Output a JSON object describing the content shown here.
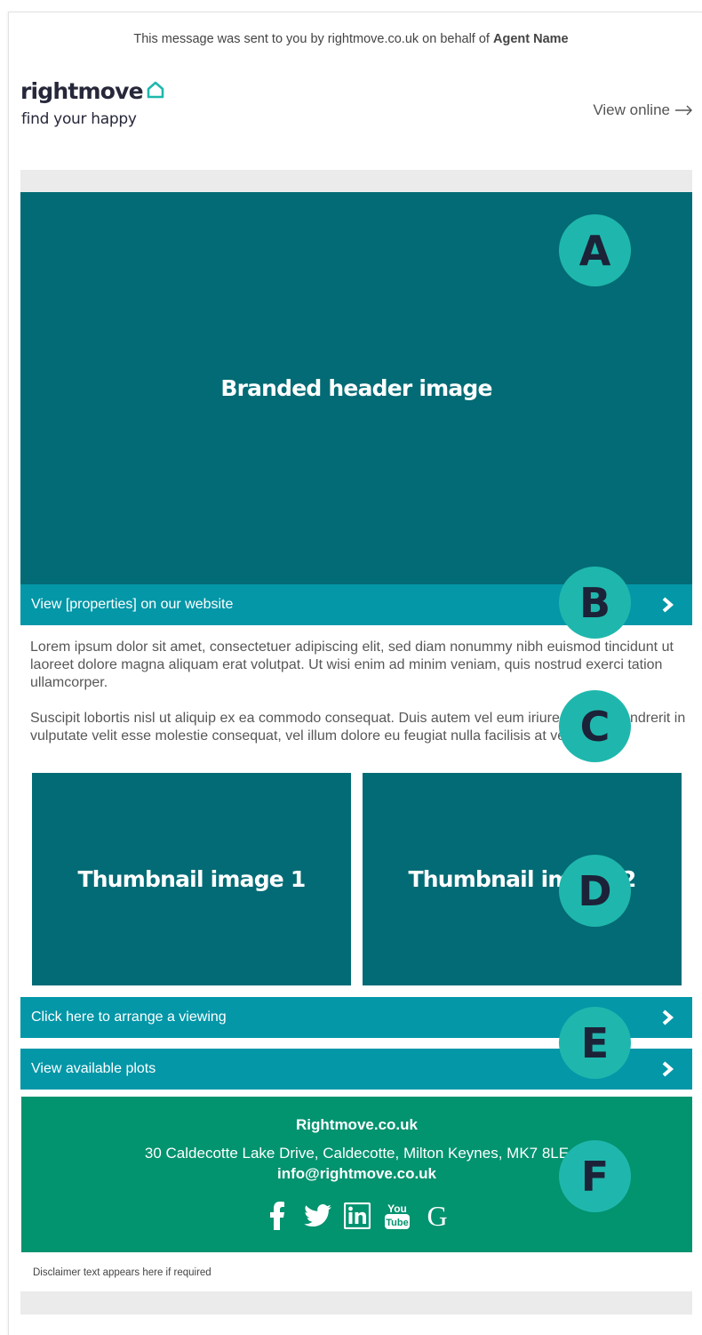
{
  "preheader": {
    "text": "This message was sent to you by rightmove.co.uk on behalf of",
    "agent_name": "Agent Name"
  },
  "logo": {
    "wordmark": "rightmove",
    "tagline": "find your happy",
    "icon": "house-outline-icon"
  },
  "view_online": {
    "label": "View online",
    "icon": "arrow-right-icon"
  },
  "header_image": {
    "label": "Branded header image"
  },
  "cta_website": {
    "label": "View [properties] on our website",
    "icon": "chevron-right-icon"
  },
  "body": {
    "paragraph_1": "Lorem ipsum dolor sit amet, consectetuer adipiscing elit, sed diam nonummy nibh euismod tincidunt ut laoreet dolore magna aliquam erat volutpat. Ut wisi enim ad minim veniam, quis nostrud exerci tation ullamcorper.",
    "paragraph_2": "Suscipit lobortis nisl ut aliquip ex ea commodo consequat. Duis autem vel eum iriure dolor in hendrerit in vulputate velit esse molestie consequat, vel illum dolore eu feugiat nulla facilisis at vero eros."
  },
  "thumbnails": [
    {
      "label": "Thumbnail image 1"
    },
    {
      "label": "Thumbnail image 2"
    }
  ],
  "cta_viewing": {
    "label": "Click here to arrange a viewing",
    "icon": "chevron-right-icon"
  },
  "cta_plots": {
    "label": "View available plots",
    "icon": "chevron-right-icon"
  },
  "footer": {
    "company": "Rightmove.co.uk",
    "address": "30 Caldecotte Lake Drive, Caldecotte, Milton Keynes, MK7 8LE",
    "email": "info@rightmove.co.uk",
    "social_icons": [
      "facebook-icon",
      "twitter-icon",
      "linkedin-icon",
      "youtube-icon",
      "google-icon"
    ],
    "youtube_text_top": "You",
    "youtube_text_bottom": "Tube",
    "google_letter": "G"
  },
  "disclaimer": "Disclaimer text appears here if required",
  "markers": [
    "A",
    "B",
    "C",
    "D",
    "E",
    "F"
  ],
  "colors": {
    "header_teal": "#036b75",
    "cta_blue": "#0397a8",
    "footer_green": "#02936f",
    "marker_teal": "#1fb7ad",
    "marker_text": "#1c2238",
    "grey_bar": "#ebebeb"
  }
}
